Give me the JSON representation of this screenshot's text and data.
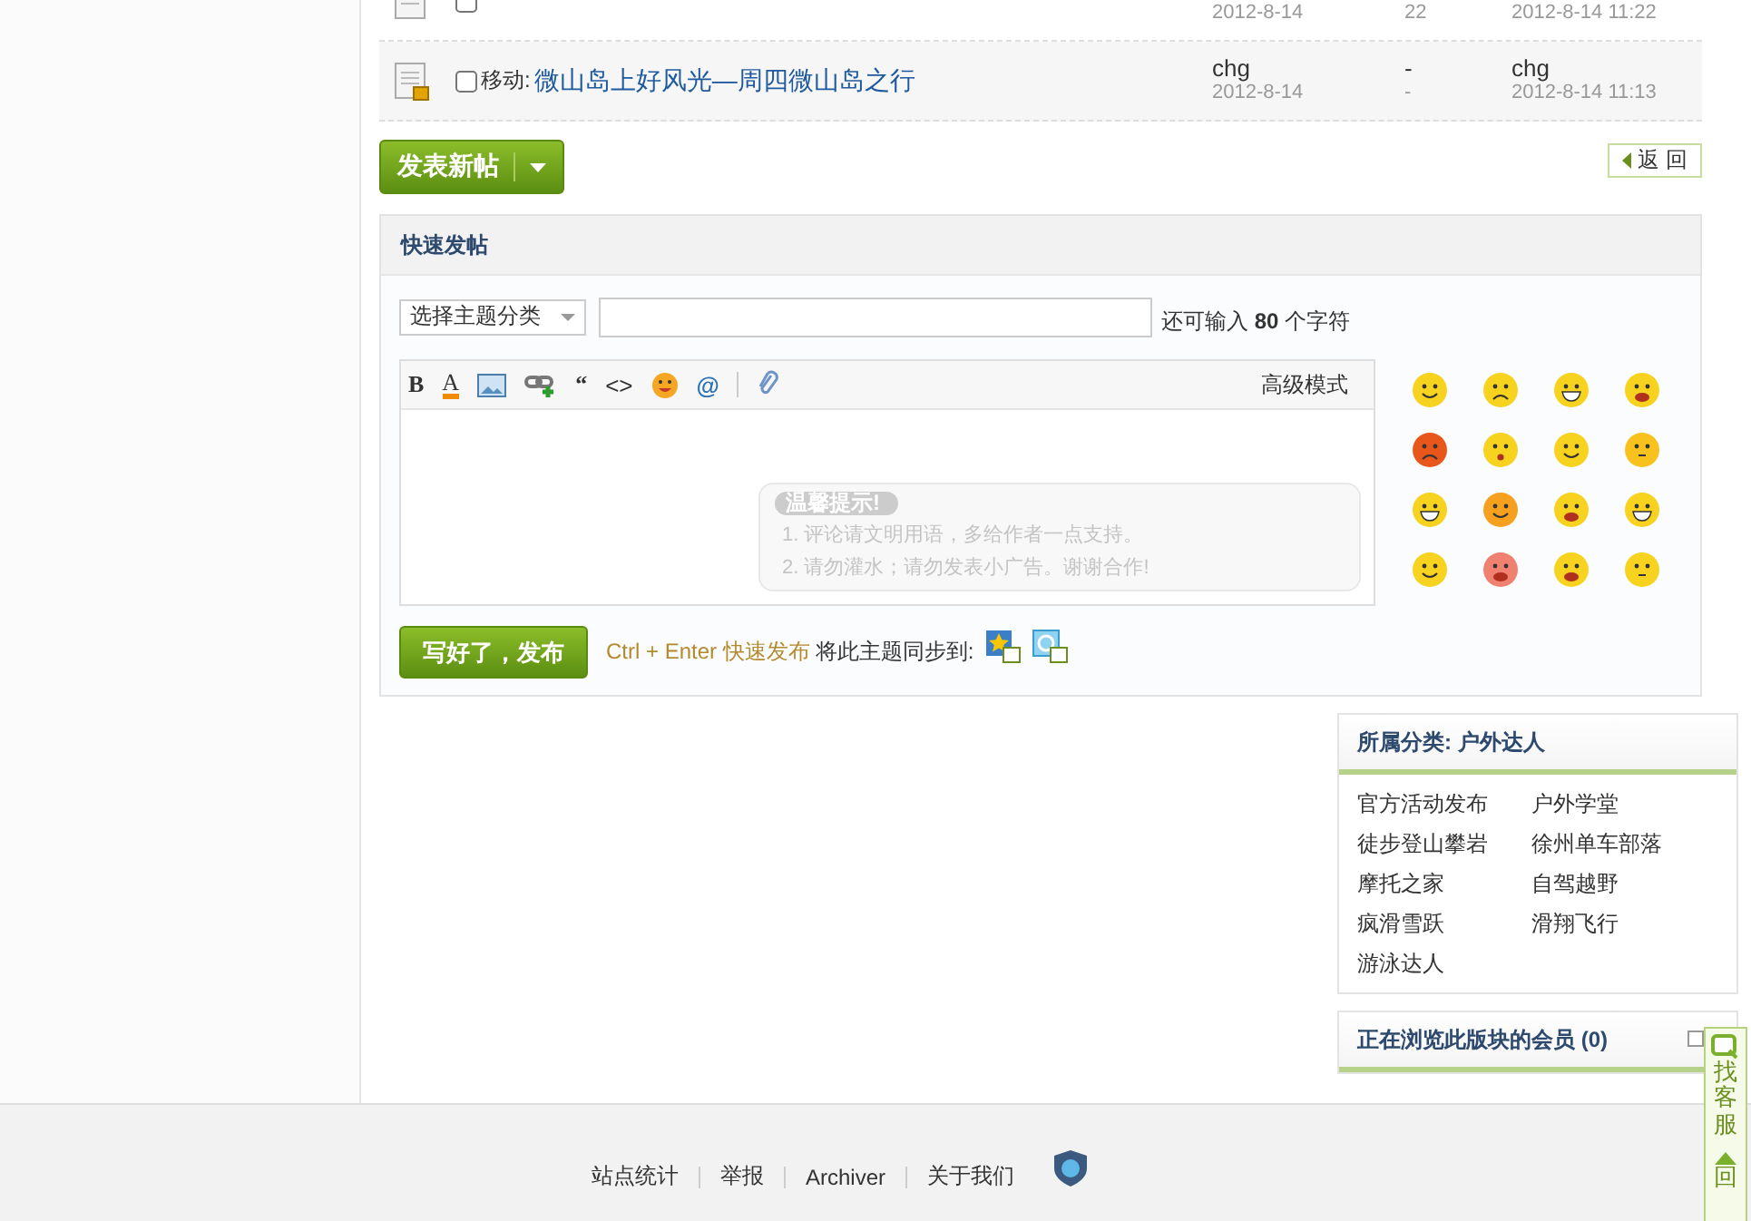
{
  "threads": [
    {
      "kind": "normal",
      "date": "2012-8-14",
      "views": "22",
      "last_time": "2012-8-14 11:22",
      "checked": false
    },
    {
      "kind": "locked",
      "prefix": "移动:",
      "prefix_link": false,
      "title": "微山岛上好风光—周四微山岛之行",
      "author": "chg",
      "date": "2012-8-14",
      "replies": "-",
      "views": "-",
      "last_user": "chg",
      "last_time": "2012-8-14 11:13",
      "checked": false
    }
  ],
  "new_post_button": "发表新帖",
  "back_button": "返 回",
  "quick_post": {
    "title": "快速发帖",
    "category_select": "选择主题分类",
    "counter_before": "还可输入",
    "counter_number": "80",
    "counter_after": "个字符",
    "toolbar": [
      {
        "kind": "bold",
        "glyph": "B"
      },
      {
        "kind": "color",
        "glyph": "A"
      },
      {
        "kind": "image"
      },
      {
        "kind": "link"
      },
      {
        "kind": "quote",
        "glyph": "“"
      },
      {
        "kind": "code",
        "glyph": "<>"
      },
      {
        "kind": "smiley"
      },
      {
        "kind": "at",
        "glyph": "@"
      },
      {
        "kind": "separator"
      },
      {
        "kind": "attach"
      }
    ],
    "advanced_mode": "高级模式",
    "tip_title": "温馨提示!",
    "tips": [
      "1. 评论请文明用语，多给作者一点支持。",
      "2. 请勿灌水；请勿发表小广告。谢谢合作!"
    ],
    "submit_button": "写好了，发布",
    "shortcut": "Ctrl + Enter 快速发布",
    "sync_label": "将此主题同步到:"
  },
  "category_box": {
    "title": "所属分类: 户外达人",
    "items": [
      "官方活动发布",
      "户外学堂",
      "徒步登山攀岩",
      "徐州单车部落",
      "摩托之家",
      "自驾越野",
      "疯滑雪跃",
      "滑翔飞行",
      "游泳达人"
    ]
  },
  "members_box": {
    "title": "正在浏览此版块的会员 (0)"
  },
  "side_widget": {
    "service": "找客服",
    "top": "回"
  },
  "footer": {
    "links": [
      "站点统计",
      "举报",
      "Archiver",
      "关于我们"
    ]
  }
}
